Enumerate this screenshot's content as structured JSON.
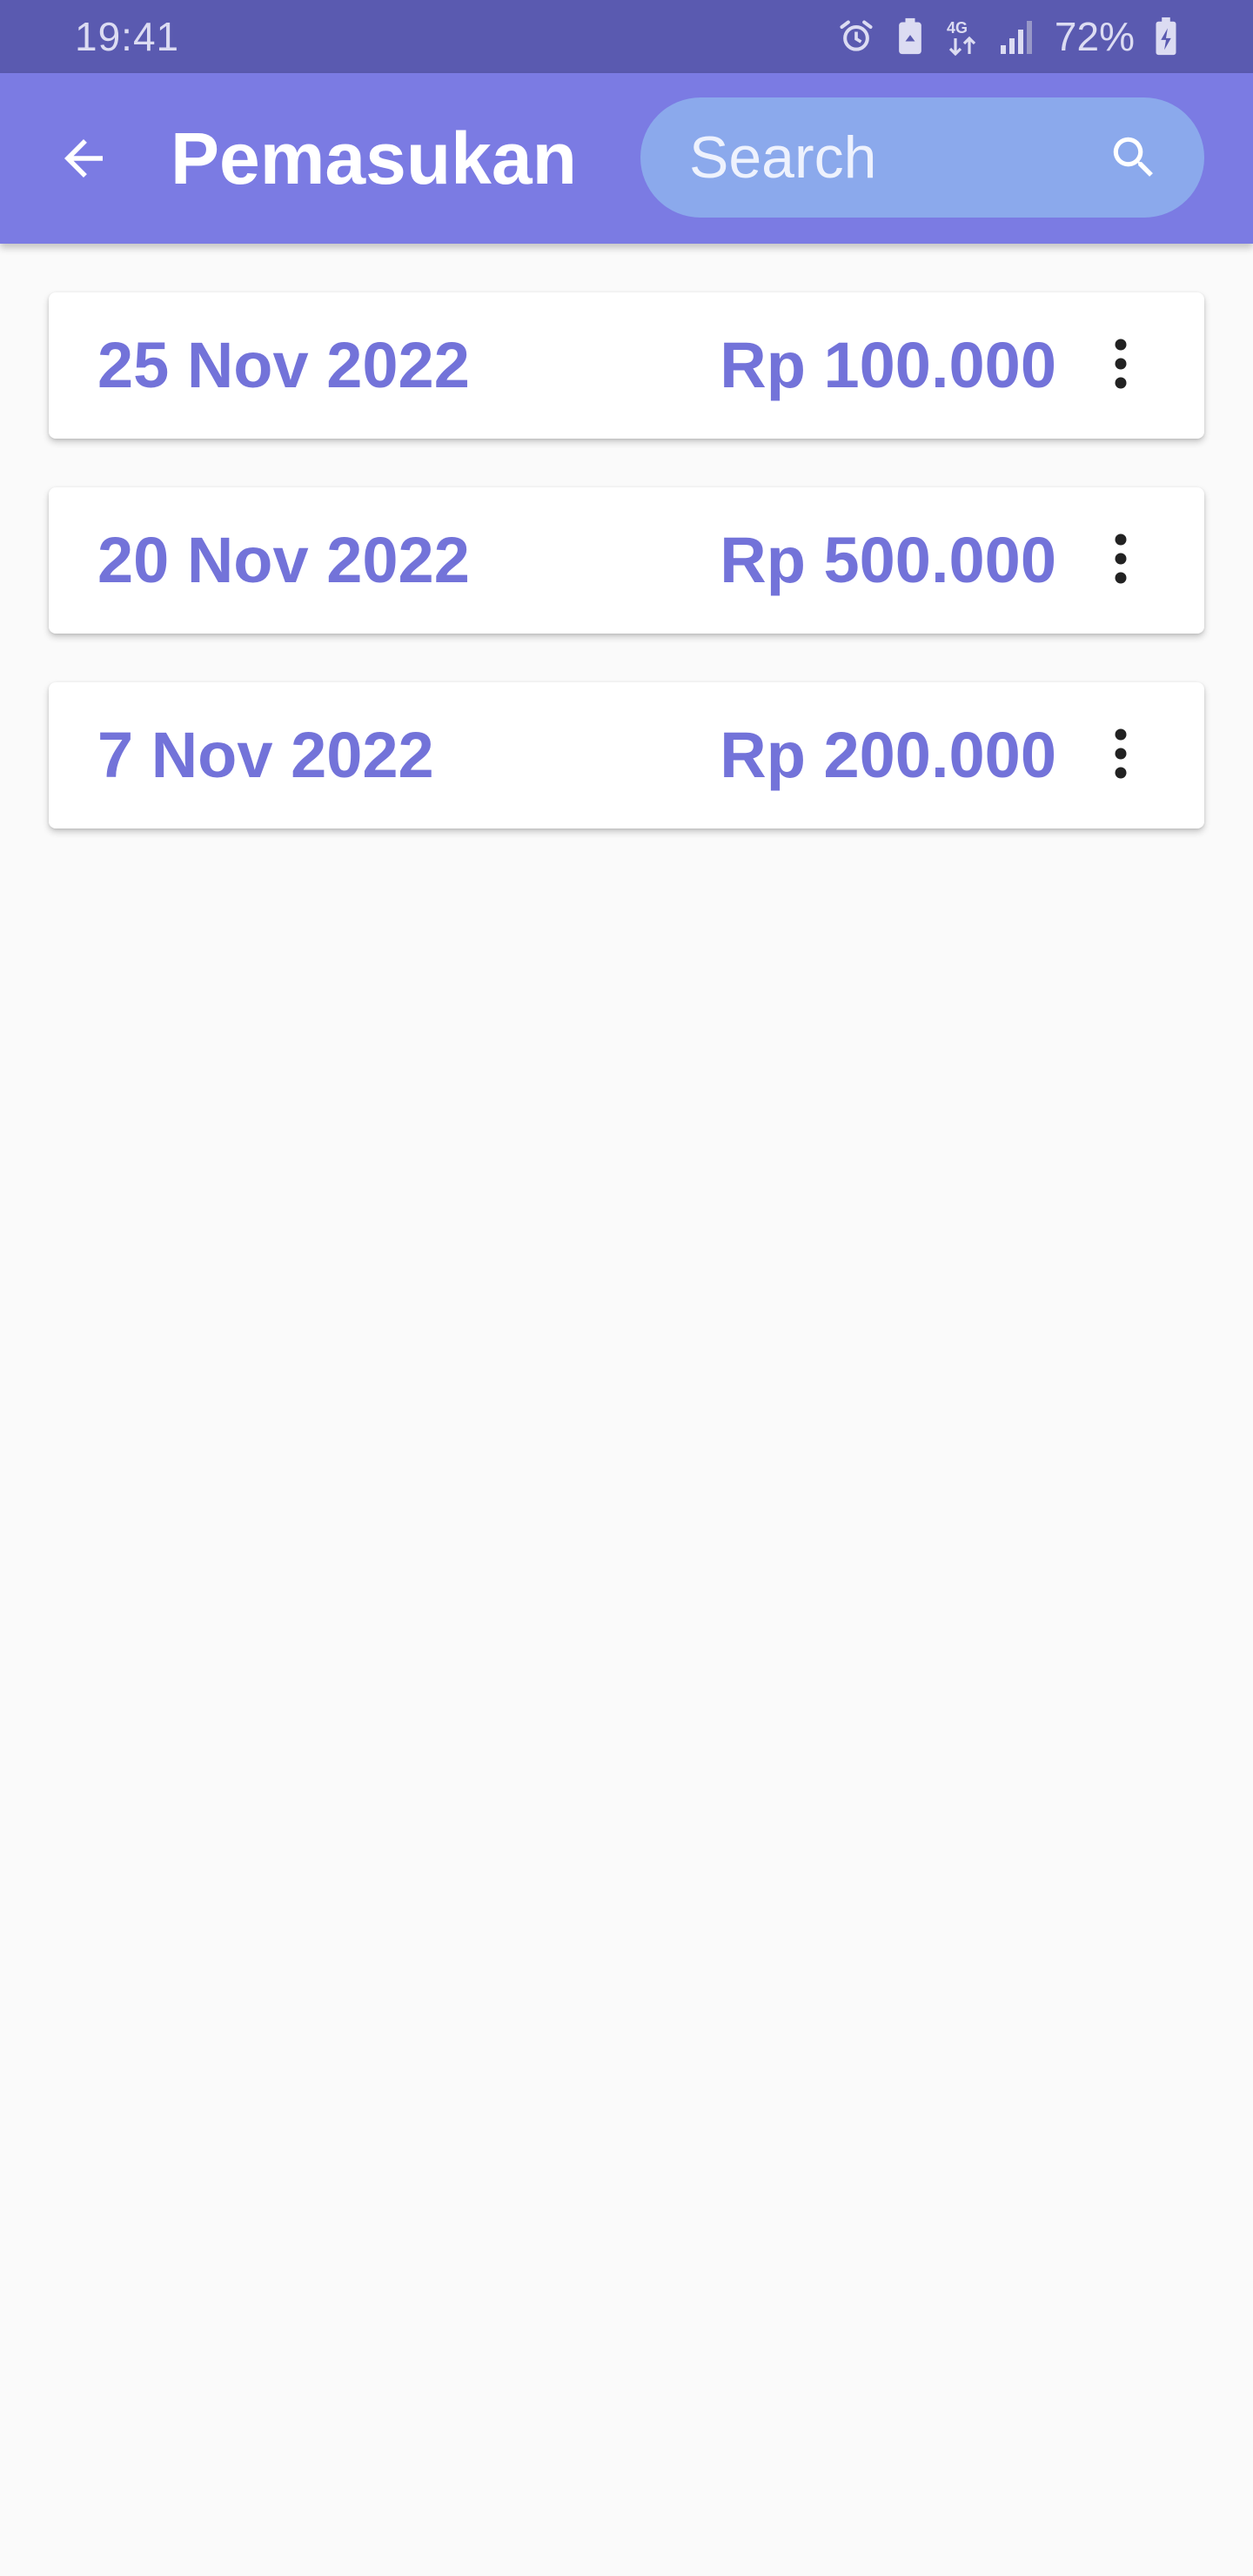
{
  "status_bar": {
    "time": "19:41",
    "network_label": "4G",
    "battery": "72%",
    "icons": [
      "alarm-icon",
      "battery-saver-icon",
      "network-4g-icon",
      "signal-icon",
      "battery-charging-icon"
    ]
  },
  "app_bar": {
    "title": "Pemasukan",
    "back_icon": "arrow-left-icon",
    "search": {
      "placeholder": "Search",
      "value": "",
      "icon": "search-icon"
    }
  },
  "income_list": [
    {
      "date": "25 Nov 2022",
      "amount": "Rp 100.000",
      "menu_icon": "more-vert-icon"
    },
    {
      "date": "20 Nov 2022",
      "amount": "Rp 500.000",
      "menu_icon": "more-vert-icon"
    },
    {
      "date": "7 Nov 2022",
      "amount": "Rp 200.000",
      "menu_icon": "more-vert-icon"
    }
  ],
  "colors": {
    "status_bar": "#5a5ab0",
    "app_bar": "#7b7be3",
    "search_box": "#8ba9ec",
    "accent_text": "#7373d9",
    "background": "#fafafa"
  }
}
